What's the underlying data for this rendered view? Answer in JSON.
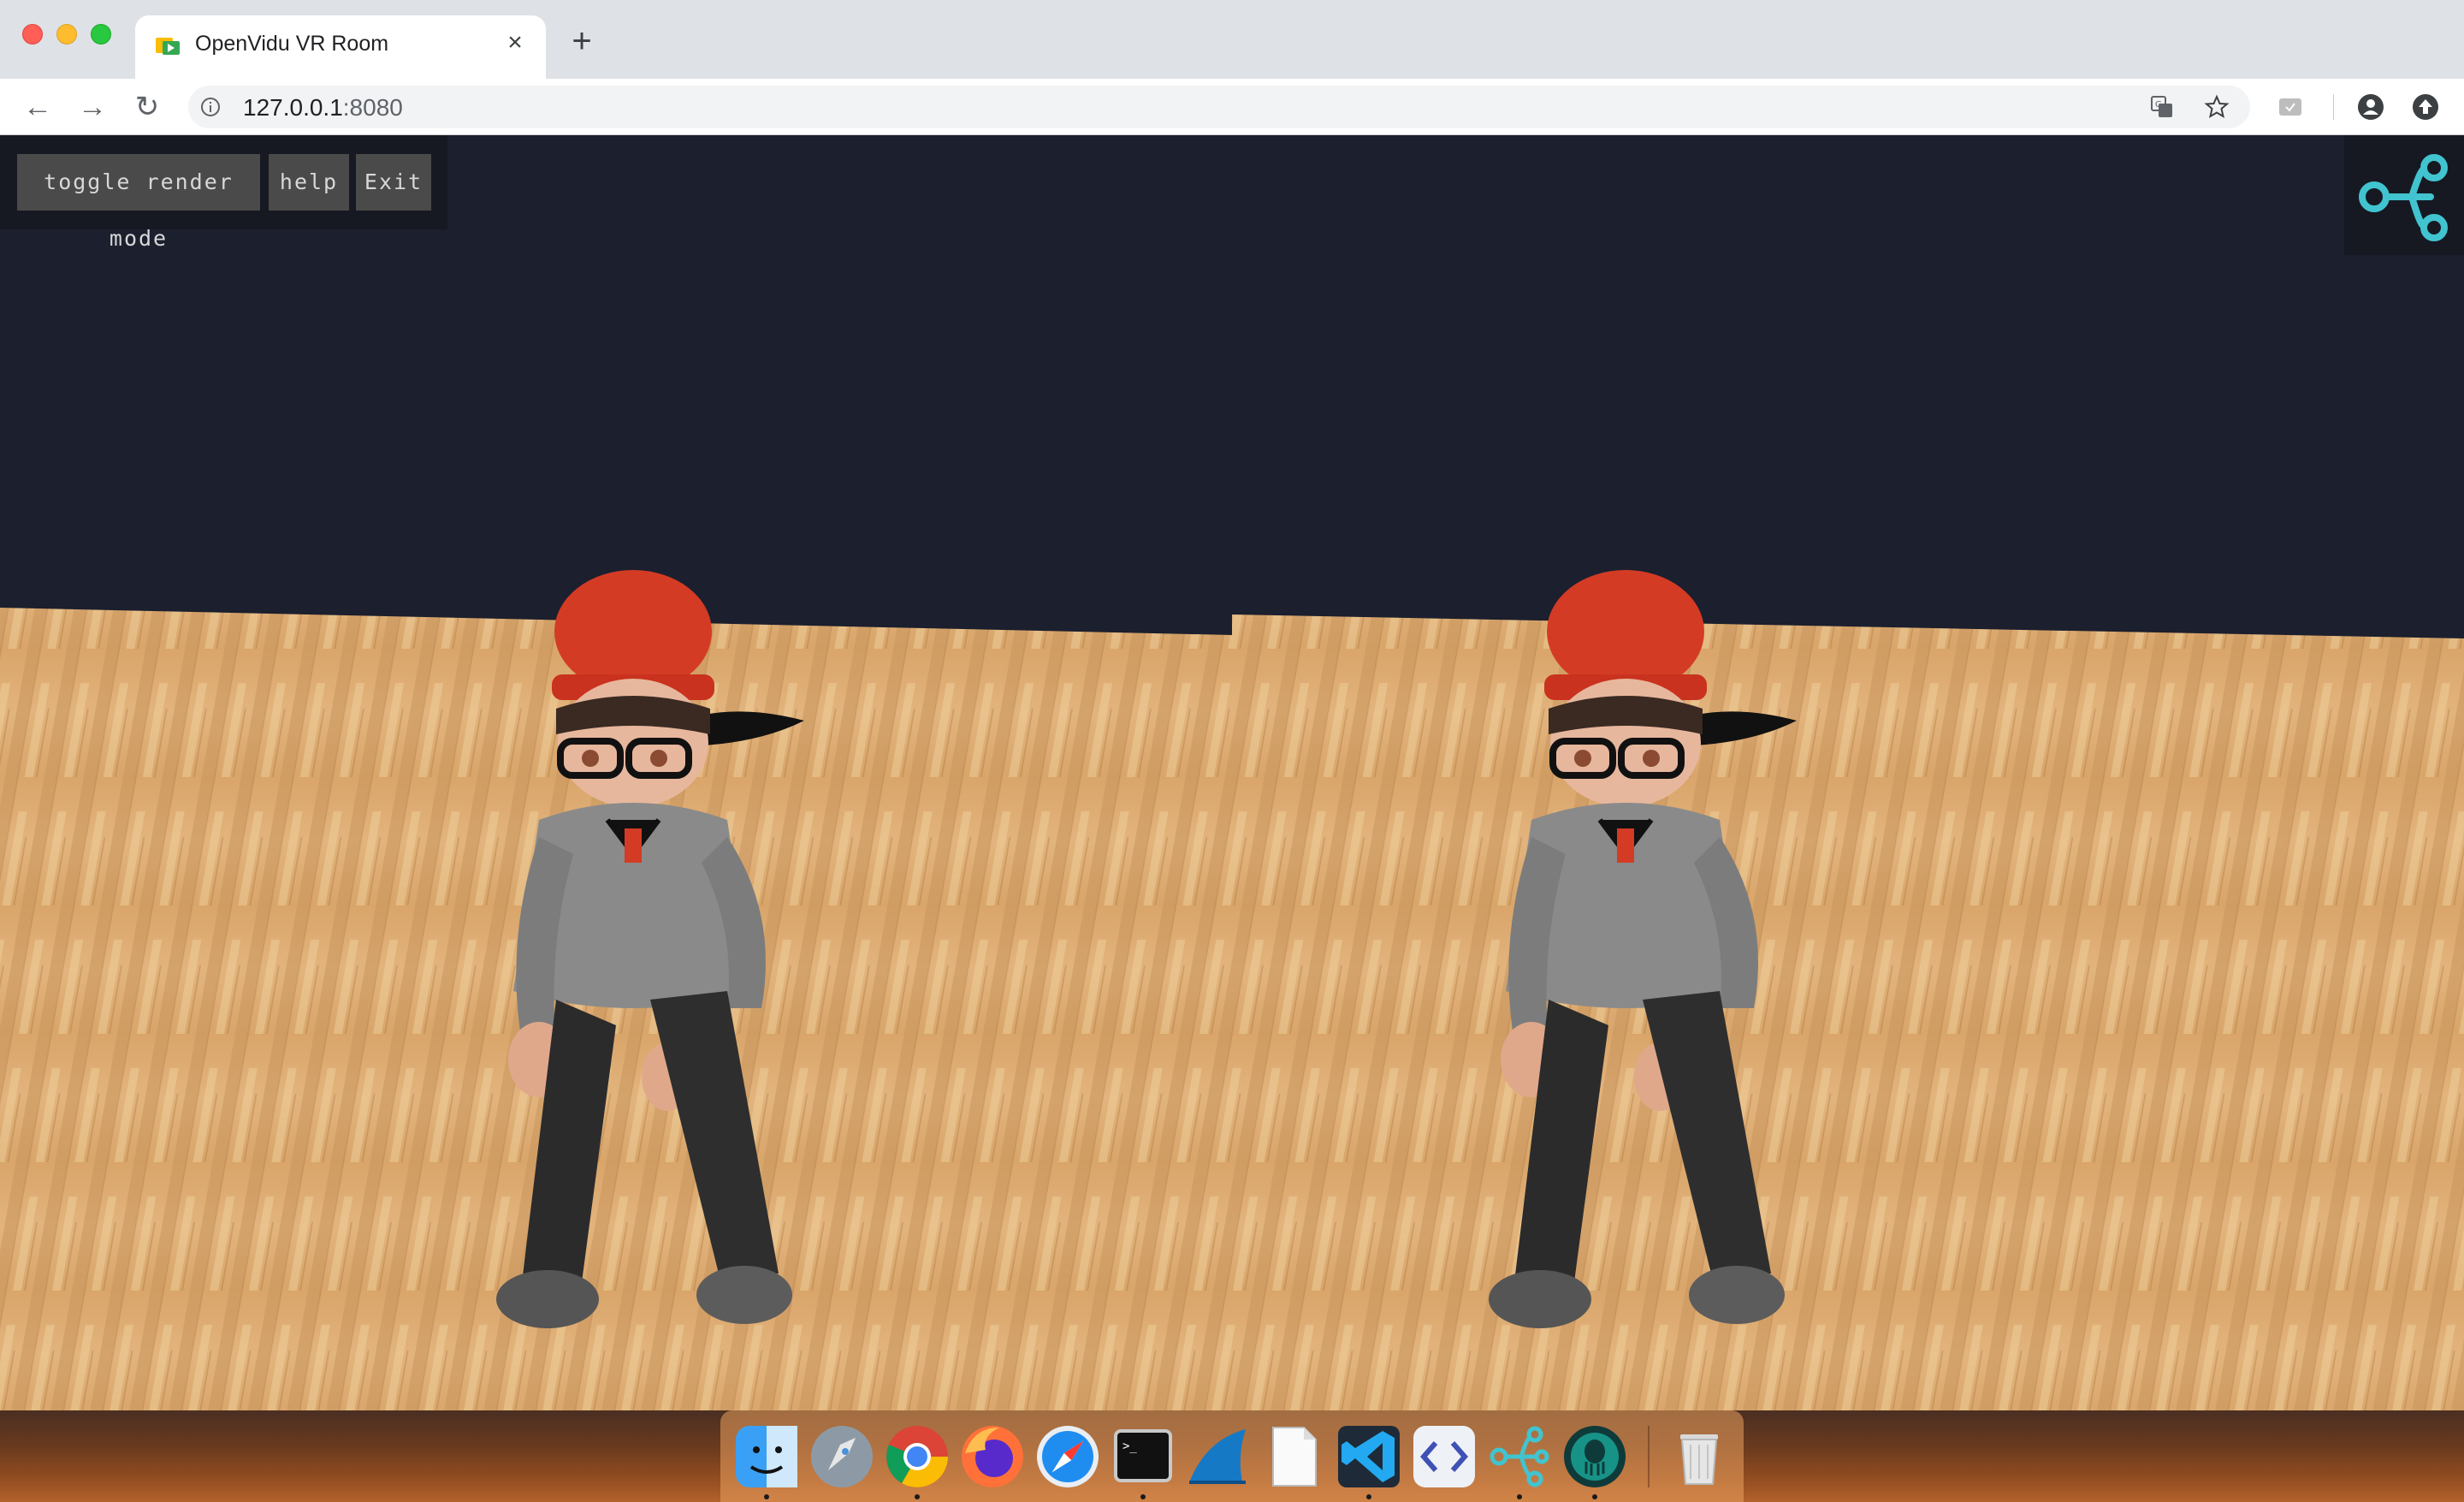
{
  "browser": {
    "tab": {
      "title": "OpenVidu VR Room",
      "close_glyph": "×"
    },
    "new_tab_glyph": "+",
    "address": {
      "host": "127.0.0.1",
      "port": ":8080"
    },
    "nav": {
      "back": "←",
      "forward": "→",
      "reload": "↻"
    }
  },
  "vr": {
    "buttons": {
      "toggle_render_mode": "toggle render mode",
      "help": "help",
      "exit": "Exit"
    },
    "logo_icon": "openvidu-logo-icon"
  },
  "dock": {
    "items": [
      "finder-icon",
      "launchpad-icon",
      "chrome-icon",
      "firefox-icon",
      "safari-icon",
      "terminal-icon",
      "wireshark-icon",
      "textedit-icon",
      "vscode-icon",
      "xcode-icon",
      "openvidu-icon",
      "gitkraken-icon"
    ],
    "trash": "trash-icon"
  },
  "colors": {
    "accent": "#41c4cf",
    "sky": "#1b1f2e",
    "floor": "#d8a66b"
  }
}
